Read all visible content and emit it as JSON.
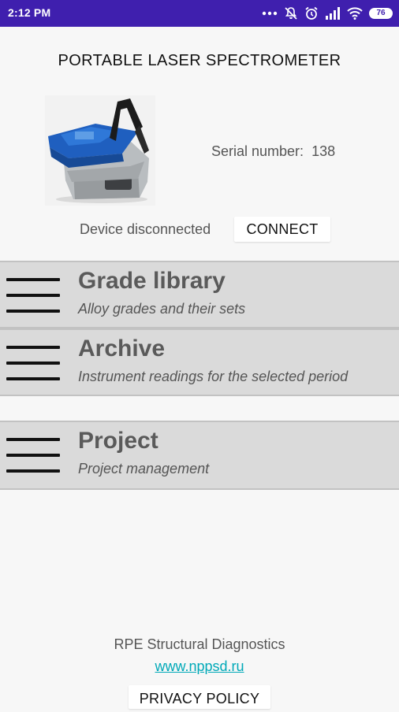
{
  "status_bar": {
    "time": "2:12 PM",
    "battery": "76",
    "background": "#3f1fae",
    "icons": [
      "dots-icon",
      "muted-icon",
      "alarm-icon",
      "signal-icon",
      "wifi-icon",
      "battery-icon"
    ]
  },
  "header": {
    "title": "PORTABLE LASER SPECTROMETER"
  },
  "device": {
    "image": "spectrometer-device-image",
    "serial_label": "Serial number:",
    "serial_value": "138"
  },
  "connection": {
    "status_text": "Device disconnected",
    "connect_label": "CONNECT"
  },
  "menu": {
    "items": [
      {
        "title": "Grade library",
        "subtitle": "Alloy grades and their sets",
        "icon": "hamburger-icon"
      },
      {
        "title": "Archive",
        "subtitle": "Instrument readings for the selected period",
        "icon": "hamburger-icon"
      },
      {
        "title": "Project",
        "subtitle": "Project management",
        "icon": "hamburger-icon"
      }
    ]
  },
  "footer": {
    "company": "RPE Structural Diagnostics",
    "website": "www.nppsd.ru",
    "privacy_label": "PRIVACY POLICY",
    "link_color": "#00a9b8"
  }
}
